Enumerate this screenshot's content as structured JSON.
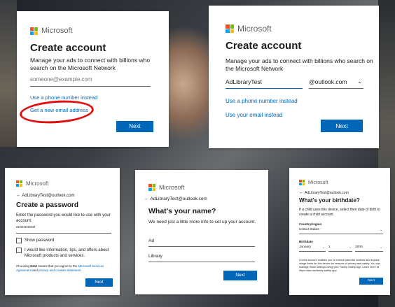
{
  "colors": {
    "microsoft_red": "#f25022",
    "microsoft_green": "#7fba00",
    "microsoft_blue": "#00a4ef",
    "microsoft_yellow": "#ffb900",
    "button_blue": "#0067b8",
    "annotation_red": "#e01010"
  },
  "icons": [
    "microsoft-logo-icon",
    "back-arrow-icon",
    "chevron-down-icon",
    "checkbox-icon"
  ],
  "brand": "Microsoft",
  "card1": {
    "title": "Create account",
    "description": "Manage your ads to connect with billions who search on the Microsoft Network",
    "email_placeholder": "someone@example.com",
    "phone_link": "Use a phone number instead",
    "new_email_link": "Get a new email address",
    "next_label": "Next"
  },
  "card2": {
    "title": "Create account",
    "description": "Manage your ads to connect with billions who search on the Microsoft Network",
    "username_value": "AdLibraryTest",
    "domain_value": "@outlook.com",
    "phone_link": "Use a phone number instead",
    "email_link": "Use your email instead",
    "next_label": "Next"
  },
  "card3": {
    "back_email": "AdLibraryTest@outlook.com",
    "title": "Create a password",
    "description": "Enter the password you would like to use with your account.",
    "password_value": "•••••••••••••",
    "show_password_label": "Show password",
    "offers_label": "I would like information, tips, and offers about Microsoft products and services.",
    "fine_print_a": "Choosing ",
    "fine_print_next": "Next",
    "fine_print_b": " means that you agree to the ",
    "fine_print_link1": "Microsoft Services Agreement",
    "fine_print_c": " and ",
    "fine_print_link2": "privacy and cookies statement",
    "fine_print_d": ".",
    "next_label": "Next"
  },
  "card4": {
    "back_email": "AdLibraryTest@outlook.com",
    "title": "What's your name?",
    "description": "We need just a little more info to set up your account.",
    "first_name_value": "Ad",
    "last_name_value": "Library",
    "next_label": "Next"
  },
  "card5": {
    "back_email": "AdLibraryTest@outlook.com",
    "title": "What's your birthdate?",
    "description": "If a child uses this device, select their date of birth to create a child account.",
    "country_label": "Country/region",
    "country_value": "United States",
    "birthdate_label": "Birthdate",
    "month_value": "January",
    "day_value": "1",
    "year_value": "2000",
    "fine_print": "A child account enables you to enforce parental controls and impose usage limits for this device for reasons of privacy and safety. You can manage these settings using your Family Safety app. Learn more at https://aka.ms/family-safety-app",
    "next_label": "Next"
  }
}
